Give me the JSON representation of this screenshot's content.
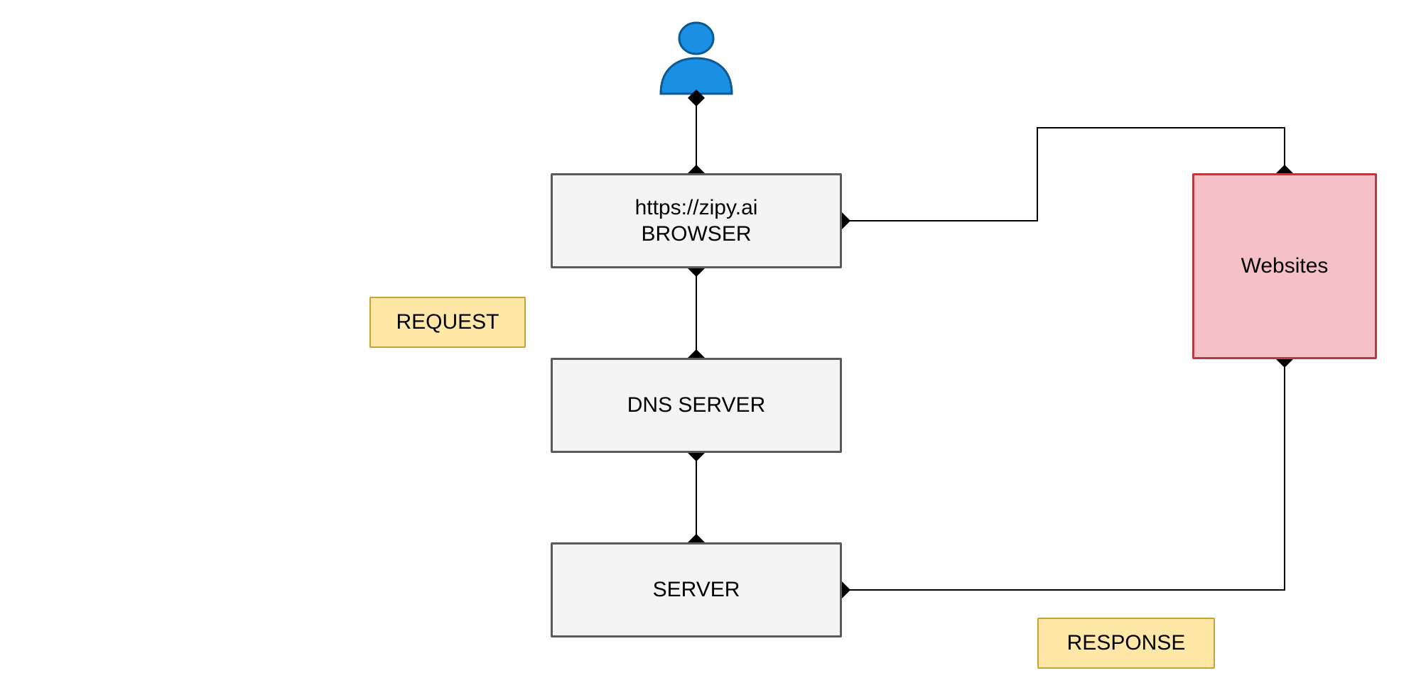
{
  "nodes": {
    "browser_url": "https://zipy.ai",
    "browser_label": "BROWSER",
    "dns": "DNS SERVER",
    "server": "SERVER",
    "websites": "Websites"
  },
  "tags": {
    "request": "REQUEST",
    "response": "RESPONSE"
  }
}
